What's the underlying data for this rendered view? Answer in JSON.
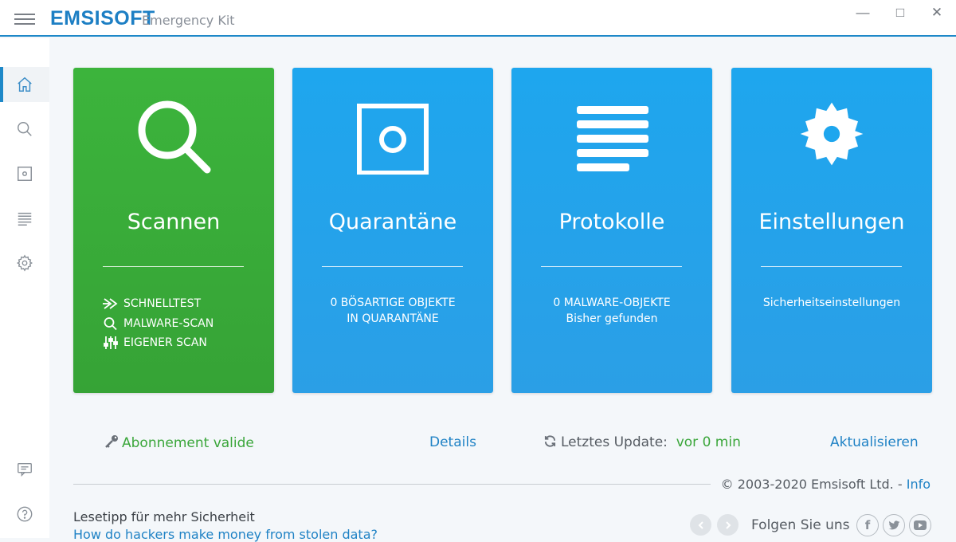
{
  "app": {
    "brand": "EMSISOFT",
    "subtitle": "Emergency Kit"
  },
  "window": {
    "minimize": "—",
    "maximize": "□",
    "close": "✕"
  },
  "sidebar": {
    "items": [
      {
        "name": "home-icon",
        "active": true
      },
      {
        "name": "search-icon",
        "active": false
      },
      {
        "name": "quarantine-icon",
        "active": false
      },
      {
        "name": "logs-icon",
        "active": false
      },
      {
        "name": "gear-icon",
        "active": false
      },
      {
        "name": "chat-icon",
        "active": false
      },
      {
        "name": "help-icon",
        "active": false
      }
    ]
  },
  "cards": {
    "scan": {
      "title": "Scannen",
      "links": [
        "SCHNELLTEST",
        "MALWARE-SCAN",
        "EIGENER SCAN"
      ],
      "color": "#3cb43c"
    },
    "quarantine": {
      "title": "Quarantäne",
      "line1": "0 BÖSARTIGE OBJEKTE",
      "line2": "IN QUARANTÄNE",
      "color": "#1ea6ee"
    },
    "logs": {
      "title": "Protokolle",
      "line1": "0 MALWARE-OBJEKTE",
      "line2": "Bisher gefunden",
      "color": "#1ea6ee"
    },
    "settings": {
      "title": "Einstellungen",
      "line1": "Sicherheitseinstellungen",
      "color": "#1ea6ee"
    }
  },
  "status": {
    "subscription": "Abonnement valide",
    "details": "Details",
    "last_update_label": "Letztes Update:",
    "last_update_value": "vor 0 min",
    "update_action": "Aktualisieren"
  },
  "footer": {
    "copyright": "© 2003-2020 Emsisoft Ltd. -",
    "info": "Info",
    "tip_label": "Lesetipp für mehr Sicherheit",
    "tip_link": "How do hackers make money from stolen data?",
    "follow": "Folgen Sie uns",
    "social": [
      "facebook-icon",
      "twitter-icon",
      "youtube-icon"
    ]
  }
}
